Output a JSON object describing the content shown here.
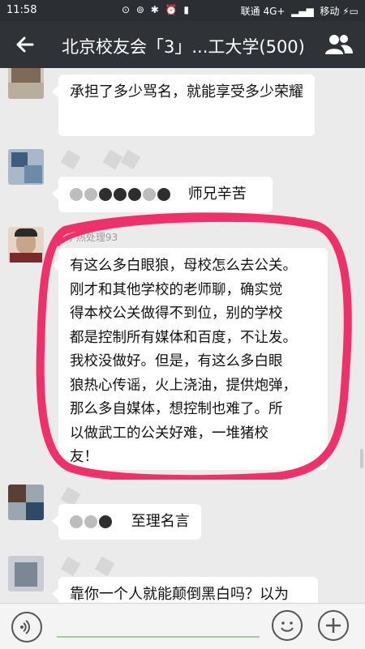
{
  "status_bar": {
    "time": "11:58",
    "carrier1": "联通 4G+",
    "carrier2": "移动"
  },
  "header": {
    "title": "北京校友会「3」...工大学(500)"
  },
  "messages": [
    {
      "text": "承担了多少骂名，就能享受多少荣耀"
    },
    {
      "text": "师兄辛苦"
    },
    {
      "sender": "勇 热处理93",
      "lines": [
        "有这么多白眼狼，母校怎么去公关。",
        "刚才和其他学校的老师聊，确实觉",
        "得本校公关做得不到位，别的学校",
        "都是控制所有媒体和百度，不让发。",
        "我校没做好。但是，有这么多白眼",
        "狼热心传谣，火上浇油，提供炮弹，",
        "那么多自媒体，想控制也难了。所",
        "以做武工的公关好难，一堆猪校",
        "友！"
      ]
    },
    {
      "text": "至理名言"
    },
    {
      "text": "靠你一个人就能颠倒黑白吗？以为"
    }
  ],
  "colors": {
    "header_bg": "#2f3236",
    "highlight_circle": "#f0306a",
    "bubble_bg": "#ffffff"
  }
}
